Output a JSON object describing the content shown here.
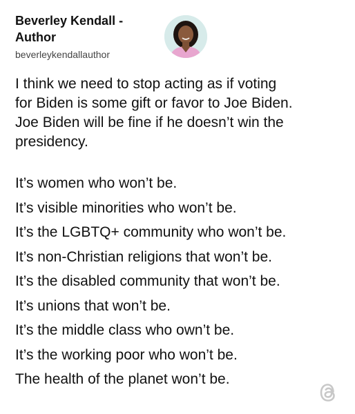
{
  "author": {
    "name": "Beverley Kendall - Author",
    "handle": "beverleykendallauthor",
    "avatar_icon": "author-avatar"
  },
  "post": {
    "intro_lines": [
      "I think we need to stop acting as if voting",
      "for Biden is some gift or favor to Joe Biden.",
      "Joe Biden will be fine if he doesn’t win the",
      "presidency."
    ],
    "lines": [
      "It’s women who won’t be.",
      "It’s visible minorities who won’t be.",
      "It’s the LGBTQ+ community who won’t be.",
      "It’s non-Christian religions that won’t be.",
      "It’s the disabled community that won’t be.",
      "It’s unions that won’t be.",
      "It’s the middle class who own’t be.",
      "It’s the working poor who won’t be.",
      "The health of the planet won’t be."
    ]
  },
  "branding": {
    "icon": "threads-logo-icon"
  },
  "colors": {
    "text": "#111111",
    "handle": "#444444",
    "background": "#ffffff",
    "logo": "#c8c8c8"
  }
}
